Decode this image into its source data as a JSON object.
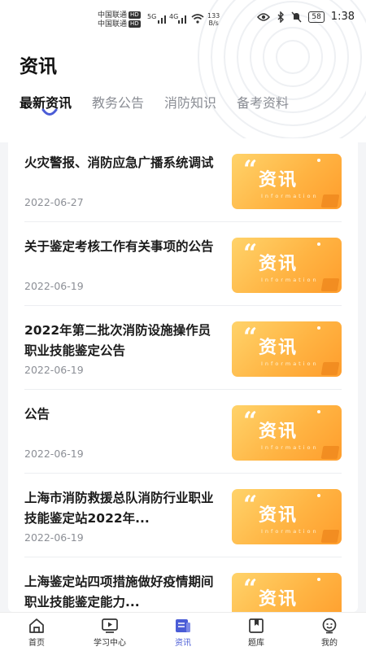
{
  "status_bar": {
    "carrier_line1": "中国联通",
    "carrier_line2": "中国联通",
    "hd": "HD",
    "net1": "5G",
    "net2": "4G",
    "speed_value": "133",
    "speed_unit": "B/s",
    "battery": "58",
    "time": "1:38"
  },
  "page": {
    "title": "资讯"
  },
  "tabs": [
    {
      "label": "最新资讯",
      "active": true
    },
    {
      "label": "教务公告",
      "active": false
    },
    {
      "label": "消防知识",
      "active": false
    },
    {
      "label": "备考资料",
      "active": false
    }
  ],
  "thumbnail": {
    "quote": "“",
    "word": "资讯",
    "sub": "Information"
  },
  "news": [
    {
      "title": "火灾警报、消防应急广播系统调试",
      "date": "2022-06-27"
    },
    {
      "title": "关于鉴定考核工作有关事项的公告",
      "date": "2022-06-19"
    },
    {
      "title": "2022年第二批次消防设施操作员职业技能鉴定公告",
      "date": "2022-06-19"
    },
    {
      "title": "公告",
      "date": "2022-06-19"
    },
    {
      "title": "上海市消防救援总队消防行业职业技能鉴定站2022年...",
      "date": "2022-06-19"
    },
    {
      "title": "上海鉴定站四项措施做好疫情期间职业技能鉴定能力...",
      "date": ""
    }
  ],
  "tabbar": [
    {
      "label": "首页",
      "icon": "home-icon",
      "active": false
    },
    {
      "label": "学习中心",
      "icon": "video-play-icon",
      "active": false
    },
    {
      "label": "资讯",
      "icon": "news-icon",
      "active": true
    },
    {
      "label": "题库",
      "icon": "question-bank-icon",
      "active": false
    },
    {
      "label": "我的",
      "icon": "profile-icon",
      "active": false
    }
  ],
  "colors": {
    "accent": "#4a5cd6",
    "thumb_start": "#ffd36a",
    "thumb_end": "#ff9d2c"
  }
}
